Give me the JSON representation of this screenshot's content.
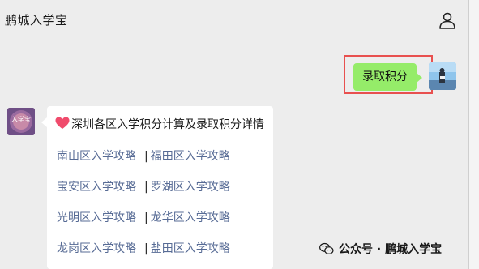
{
  "header": {
    "title": "鹏城入学宝",
    "profile_icon": "person-icon"
  },
  "sent_message": {
    "text": "录取积分",
    "bubble_color": "#95ec69",
    "highlight_color": "#e8504f"
  },
  "received_message": {
    "avatar_text": "入学宝",
    "title": "深圳各区入学积分计算及录取积分详情",
    "title_icon": "heart-icon",
    "link_color": "#576b95",
    "rows": [
      {
        "left": "南山区入学攻略",
        "sep": "|",
        "right": "福田区入学攻略"
      },
      {
        "left": "宝安区入学攻略",
        "sep": "|",
        "right": "罗湖区入学攻略"
      },
      {
        "left": "光明区入学攻略",
        "sep": "|",
        "right": "龙华区入学攻略"
      },
      {
        "left": "龙岗区入学攻略",
        "sep": "|",
        "right": "盐田区入学攻略"
      }
    ]
  },
  "watermark": {
    "icon": "wechat-icon",
    "text": "公众号 · 鹏城入学宝"
  }
}
